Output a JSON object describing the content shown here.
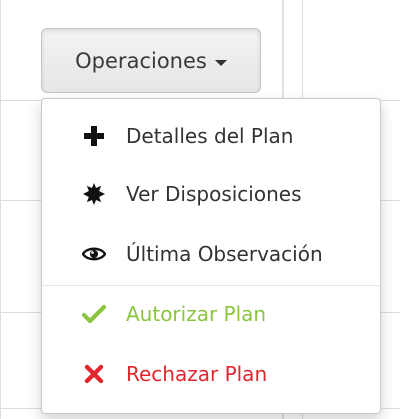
{
  "button": {
    "label": "Operaciones"
  },
  "menu": {
    "items": [
      {
        "label": "Detalles del Plan",
        "icon": "plus-icon"
      },
      {
        "label": "Ver Disposiciones",
        "icon": "burst-icon"
      },
      {
        "label": "Última Observación",
        "icon": "eye-icon"
      },
      {
        "label": "Autorizar Plan",
        "icon": "check-icon",
        "color": "#8bc53f"
      },
      {
        "label": "Rechazar Plan",
        "icon": "x-icon",
        "color": "#e3262d"
      }
    ]
  }
}
